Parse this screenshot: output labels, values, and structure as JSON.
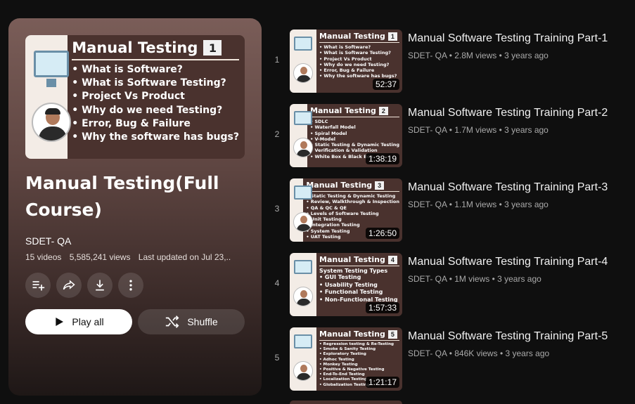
{
  "playlist": {
    "hero": {
      "title": "Manual Testing",
      "number": "1",
      "bullets": [
        "What is Software?",
        "What is Software Testing?",
        "Project Vs Product",
        "Why do we need Testing?",
        "Error, Bug & Failure",
        "Why the software has bugs?"
      ]
    },
    "title": "Manual Testing(Full Course)",
    "channel": "SDET- QA",
    "video_count": "15 videos",
    "views": "5,585,241 views",
    "updated": "Last updated on Jul 23,..",
    "play_label": "Play all",
    "shuffle_label": "Shuffle"
  },
  "videos": [
    {
      "index": "1",
      "thumb_title": "Manual Testing",
      "thumb_num": "1",
      "thumb_bullets": [
        "What is Software?",
        "What is Software Testing?",
        "Project Vs Product",
        "Why do we need Testing?",
        "Error, Bug & Failure",
        "Why the software has bugs?"
      ],
      "duration": "52:37",
      "title": "Manual Software Testing Training Part-1",
      "channel": "SDET- QA",
      "views": "2.8M views",
      "age": "3 years ago"
    },
    {
      "index": "2",
      "thumb_title": "Manual Testing",
      "thumb_num": "2",
      "thumb_bullets": [
        "SDLC",
        "Waterfall Model",
        "Spiral Model",
        "V-Model",
        "Static Testing & Dynamic Testing",
        "Verification & Validation",
        "White Box & Black Box"
      ],
      "duration": "1:38:19",
      "title": "Manual Software Testing Training Part-2",
      "channel": "SDET- QA",
      "views": "1.7M views",
      "age": "3 years ago"
    },
    {
      "index": "3",
      "thumb_title": "Manual Testing",
      "thumb_num": "3",
      "thumb_bullets": [
        "Static Testing & Dynamic Testing",
        "Review, Walkthrough & Inspection",
        "QA & QC & QE",
        "Levels of Software Testing",
        "Unit Testing",
        "Integration Testing",
        "System Testing",
        "UAT Testing"
      ],
      "duration": "1:26:50",
      "title": "Manual Software Testing Training Part-3",
      "channel": "SDET- QA",
      "views": "1.1M views",
      "age": "3 years ago"
    },
    {
      "index": "4",
      "thumb_title": "Manual Testing",
      "thumb_num": "4",
      "thumb_subtitle": "System Testing Types",
      "thumb_bullets": [
        "GUI Testing",
        "Usability Testing",
        "Functional Testing",
        "Non-Functional Testing"
      ],
      "duration": "1:57:33",
      "title": "Manual Software Testing Training Part-4",
      "channel": "SDET- QA",
      "views": "1M views",
      "age": "3 years ago"
    },
    {
      "index": "5",
      "thumb_title": "Manual Testing",
      "thumb_num": "5",
      "thumb_bullets": [
        "Regression testing & Re-Testing",
        "Smoke & Sanity Testing",
        "Exploratory Testing",
        "Adhoc Testing",
        "Monkey Testing",
        "Positive & Negative Testing",
        "End-To-End Testing",
        "Localization Testing",
        "Globalization Testing"
      ],
      "duration": "1:21:17",
      "title": "Manual Software Testing Training Part-5",
      "channel": "SDET- QA",
      "views": "846K views",
      "age": "3 years ago"
    }
  ],
  "icons": {
    "save": "add-to-queue-icon",
    "share": "share-icon",
    "download": "download-icon",
    "more": "more-vert-icon",
    "play": "play-icon",
    "shuffle": "shuffle-icon"
  }
}
